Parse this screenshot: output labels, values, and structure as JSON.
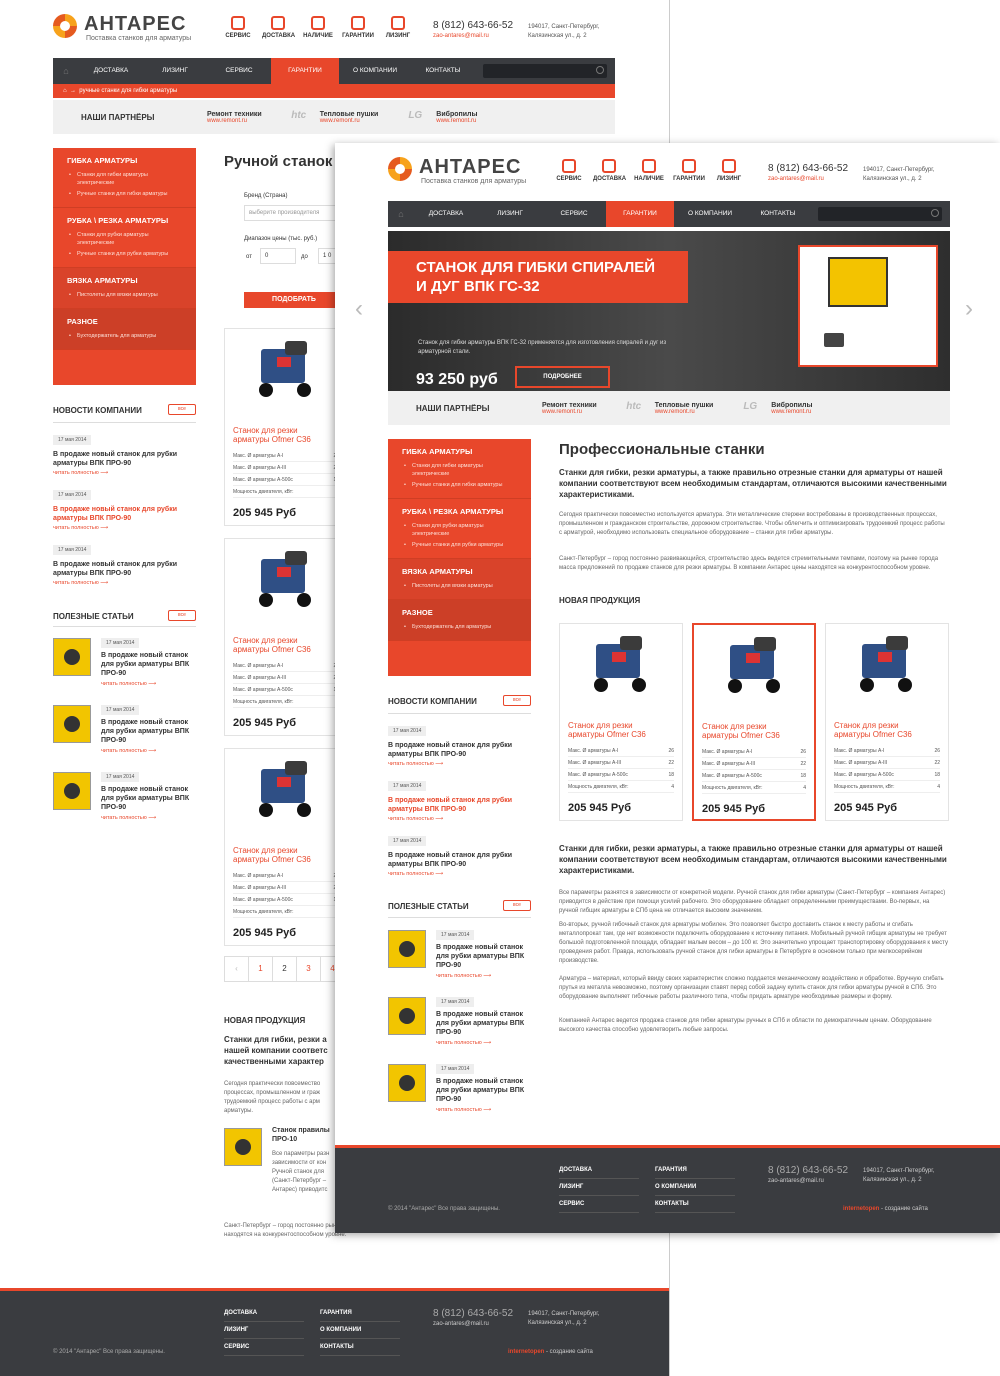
{
  "logo": {
    "name": "АНТАРЕС",
    "tagline": "Поставка станков для арматуры"
  },
  "topicons": [
    "СЕРВИС",
    "ДОСТАВКА",
    "НАЛИЧИЕ",
    "ГАРАНТИИ",
    "ЛИЗИНГ"
  ],
  "contacts": {
    "phone": "8 (812) 643-66-52",
    "email": "zao-antares@mail.ru",
    "addr1": "194017, Санкт-Петербург,",
    "addr2": "Калязинская ул., д. 2"
  },
  "nav": [
    "ДОСТАВКА",
    "ЛИЗИНГ",
    "СЕРВИС",
    "ГАРАНТИИ",
    "О КОМПАНИИ",
    "КОНТАКТЫ"
  ],
  "breadcrumb": "ручные станки для гибки арматуры",
  "partners": {
    "label": "НАШИ ПАРТНЁРЫ",
    "items": [
      {
        "logo": "",
        "t1": "Ремонт техники",
        "t2": "www.remont.ru"
      },
      {
        "logo": "htc",
        "t1": "Тепловые пушки",
        "t2": "www.remont.ru"
      },
      {
        "logo": "LG",
        "t1": "Вибропилы",
        "t2": "www.remont.ru"
      }
    ]
  },
  "cats": [
    {
      "title": "ГИБКА АРМАТУРЫ",
      "items": [
        "Станки для гибки арматуры электрические",
        "Ручные станки для гибки арматуры"
      ]
    },
    {
      "title": "РУБКА \\ РЕЗКА АРМАТУРЫ",
      "items": [
        "Станки для рубки арматуры электрические",
        "Ручные станки для рубки арматуры"
      ]
    },
    {
      "title": "ВЯЗКА АРМАТУРЫ",
      "items": [
        "Пистолеты для вязки арматуры"
      ]
    },
    {
      "title": "РАЗНОЕ",
      "items": [
        "Бухтодержатель для арматуры"
      ]
    }
  ],
  "news": {
    "title": "НОВОСТИ КОМПАНИИ",
    "all": "все",
    "items": [
      {
        "date": "17 мая 2014",
        "text": "В продаже новый станок для рубки арматуры ВПК ПРО-90",
        "more": "читать полностью"
      },
      {
        "date": "17 мая 2014",
        "text": "В продаже новый станок для рубки арматуры ВПК ПРО-90",
        "more": "читать полностью"
      },
      {
        "date": "17 мая 2014",
        "text": "В продаже новый станок для рубки арматуры ВПК ПРО-90",
        "more": "читать полностью"
      }
    ]
  },
  "articles": {
    "title": "ПОЛЕЗНЫЕ СТАТЬИ",
    "all": "все",
    "items": [
      {
        "date": "17 мая 2014",
        "text": "В продаже новый станок для рубки арматуры ВПК ПРО-90",
        "more": "читать полностью"
      },
      {
        "date": "17 мая 2014",
        "text": "В продаже новый станок для рубки арматуры ВПК ПРО-90",
        "more": "читать полностью"
      },
      {
        "date": "17 мая 2014",
        "text": "В продаже новый станок для рубки арматуры ВПК ПРО-90",
        "more": "читать полностью"
      }
    ]
  },
  "product": {
    "name": "Станок для резки арматуры Ofmer C36",
    "specs": [
      [
        "Макс. Ø арматуры А-I",
        "26"
      ],
      [
        "Макс. Ø арматуры А-III",
        "22"
      ],
      [
        "Макс. Ø арматуры А-500с",
        "18"
      ],
      [
        "Мощность двигателя, кВт:",
        "4"
      ]
    ],
    "price": "205 945 Руб",
    "price_b": "205 945 Руб"
  },
  "catalog": {
    "title": "Ручной станок",
    "brand": "Бренд (Страна)",
    "brand_ph": "выберите производителя",
    "price_range": "Диапазон цены (тыс. руб.)",
    "from": "от",
    "to": "до",
    "from_val": "0",
    "to_val": "1 0",
    "apply": "ПОДОБРАТЬ",
    "pages": [
      "1",
      "2",
      "3",
      "4"
    ]
  },
  "lowerA": {
    "new": "НОВАЯ ПРОДУКЦИЯ",
    "lead": "Станки для гибки, резки а нашей компании соответс качественными характер",
    "p1": "Сегодня практически повсемество процессах, промышленном и граж трудоемкий процесс работы с арм арматуры.",
    "art_title": "Станок правилы ПРО-10",
    "art_text": "Все параметры разн зависимости от кон Ручной станок для (Санкт-Петербург – Антарес) приводитс",
    "p2": "Санкт-Петербург – город постоянно рынке города масса предложений по продаже станков для резки арматуры. В компании Антарес цены находятся на конкурентоспособном уровне."
  },
  "hero": {
    "title": "СТАНОК ДЛЯ ГИБКИ СПИРАЛЕЙ И ДУГ ВПК ГС-32",
    "text": "Станок для гибки арматуры ВПК ГС-32 применяется для изготовления спиралей и дуг из арматурной стали.",
    "price": "93 250 руб",
    "btn": "ПОДРОБНЕЕ"
  },
  "main": {
    "h1": "Профессиональные станки",
    "lead1": "Станки для гибки, резки арматуры, а также правильно отрезные станки для арматуры от нашей компании соответствуют всем необходимым стандартам, отличаются высокими качественными характеристиками.",
    "p1": "Сегодня практически повсеместно используется арматура. Эти металлические стержни востребованы в производственных процессах, промышленном и гражданском строительстве, дорожном строительстве. Чтобы облегчить и оптимизировать трудоемкий процесс работы с арматурой, необходимо использовать специальное оборудование – станки для гибки арматуры.",
    "p2": "Санкт-Петербург – город постоянно развивающийся, строительство здесь ведется стремительными темпами, поэтому на рынке города масса предложений по продаже станков для резки арматуры. В компании Антарес цены находятся на конкурентоспособном уровне.",
    "new": "НОВАЯ ПРОДУКЦИЯ",
    "lead2": "Станки для гибки, резки арматуры, а также правильно отрезные станки для арматуры от нашей компании соответствуют всем необходимым стандартам, отличаются высокими качественными характеристиками.",
    "p3": "Все параметры разнятся в зависимости от конкретной модели. Ручной станок для гибки арматуры (Санкт-Петербург – компания Антарес) приводится в действие при помощи усилий рабочего. Это оборудование обладает определенными преимуществами. Во-первых, на ручной гибщик арматуры в СПб цена не отличается высоким значением.",
    "p4": "Во-вторых, ручной гибочный станок для арматуры мобилен. Это позволяет быстро доставить станок к месту работы и сгибать металлопрокат там, где нет возможности подключить оборудование к источнику питания. Мобильный ручной гибщик арматуры не требует большой подготовленной площади, обладает малым весом – до 100 кг. Это значительно упрощает транспортировку оборудования к месту проведения работ. Правда, использовать ручной станок для гибки арматуры в Петербурге в основном только при мелкосерийном производстве.",
    "p5": "Арматура – материал, который ввиду своих характеристик сложно поддается механическому воздействию и обработке. Вручную сгибать прутья из металла невозможно, поэтому организации ставят перед собой задачу купить станок для гибки арматуры ручной в СПб. Это оборудование выполняет гибочные работы различного типа, чтобы придать арматуре необходимые размеры и форму.",
    "p6": "Компанией Антарес ведется продажа станков для гибки арматуры ручных в СПб и области по демократичным ценам. Оборудование высокого качества способно удовлетворить любые запросы."
  },
  "footer": {
    "col1": [
      "ДОСТАВКА",
      "ЛИЗИНГ",
      "СЕРВИС"
    ],
    "col2": [
      "ГАРАНТИЯ",
      "О КОМПАНИИ",
      "КОНТАКТЫ"
    ],
    "copy": "© 2014 \"Антарес\" Все права защищены.",
    "dev": "internetopen",
    "dev_suffix": " - создание сайта"
  },
  "colors": {
    "accent": "#e8472b",
    "dark": "#3a3c40"
  }
}
